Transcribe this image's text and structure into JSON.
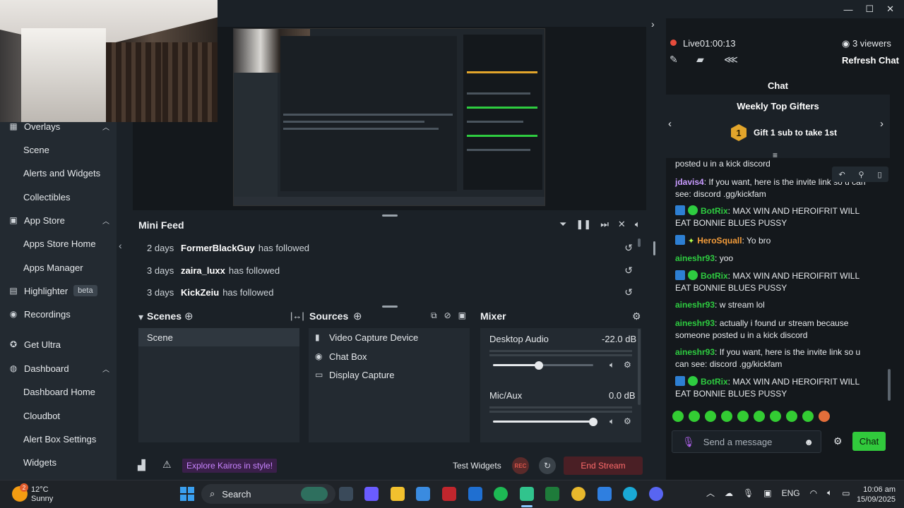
{
  "sidebar": {
    "items": [
      {
        "label": "Overlays",
        "icon": "grid-icon",
        "type": "head",
        "expanded": true
      },
      {
        "label": "Scene",
        "type": "sub"
      },
      {
        "label": "Alerts and Widgets",
        "type": "sub"
      },
      {
        "label": "Collectibles",
        "type": "sub"
      },
      {
        "label": "App Store",
        "icon": "store-icon",
        "type": "head",
        "expanded": true
      },
      {
        "label": "Apps Store Home",
        "type": "sub"
      },
      {
        "label": "Apps Manager",
        "type": "sub"
      },
      {
        "label": "Highlighter",
        "icon": "highlighter-icon",
        "type": "head",
        "badge": "beta"
      },
      {
        "label": "Recordings",
        "icon": "record-icon",
        "type": "head"
      },
      {
        "label": "Get Ultra",
        "icon": "ultra-icon",
        "type": "head"
      },
      {
        "label": "Dashboard",
        "icon": "dashboard-icon",
        "type": "head",
        "expanded": true
      },
      {
        "label": "Dashboard Home",
        "type": "sub"
      },
      {
        "label": "Cloudbot",
        "type": "sub"
      },
      {
        "label": "Alert Box Settings",
        "type": "sub"
      },
      {
        "label": "Widgets",
        "type": "sub"
      }
    ]
  },
  "mini_feed": {
    "title": "Mini Feed",
    "rows": [
      {
        "age": "2 days",
        "user": "FormerBlackGuy",
        "action": "has followed"
      },
      {
        "age": "3 days",
        "user": "zaira_luxx",
        "action": "has followed"
      },
      {
        "age": "3 days",
        "user": "KickZeiu",
        "action": "has followed"
      }
    ]
  },
  "scenes": {
    "title": "Scenes",
    "items": [
      "Scene"
    ]
  },
  "sources": {
    "title": "Sources",
    "items": [
      {
        "label": "Video Capture Device",
        "icon": "camera-icon"
      },
      {
        "label": "Chat Box",
        "icon": "chat-icon"
      },
      {
        "label": "Display Capture",
        "icon": "monitor-icon"
      }
    ]
  },
  "mixer": {
    "title": "Mixer",
    "channels": [
      {
        "label": "Desktop Audio",
        "db": "-22.0 dB",
        "level": 0.46
      },
      {
        "label": "Mic/Aux",
        "db": "0.0 dB",
        "level": 1.0
      }
    ]
  },
  "bottom_bar": {
    "kairos": "Explore Kairos in style!",
    "test_widgets": "Test Widgets",
    "rec": "REC",
    "end_stream": "End Stream"
  },
  "chat_panel": {
    "live": "Live",
    "live_time": "01:00:13",
    "viewers": "3 viewers",
    "refresh": "Refresh Chat",
    "header": "Chat",
    "gifters_title": "Weekly Top Gifters",
    "gift_rank": "1",
    "gift_text": "Gift 1 sub to take 1st",
    "messages": [
      {
        "user": "",
        "text": "posted u in a kick discord",
        "color": "#e6e9ec"
      },
      {
        "user": "jdavis4",
        "text": "If you want, here is the invite link so u can see: discord .gg/kickfam",
        "color": "#c89bff"
      },
      {
        "user": "BotRix",
        "text": "MAX WIN AND HEROIFRIT WILL EAT BONNIE BLUES PUSSY",
        "color": "#2ecc40",
        "bot": true
      },
      {
        "user": "HeroSquall",
        "text": "Yo bro",
        "color": "#f39c3a",
        "star": true
      },
      {
        "user": "aineshr93",
        "text": "yoo",
        "color": "#2ecc40"
      },
      {
        "user": "BotRix",
        "text": "MAX WIN AND HEROIFRIT WILL EAT BONNIE BLUES PUSSY",
        "color": "#2ecc40",
        "bot": true
      },
      {
        "user": "aineshr93",
        "text": "w stream lol",
        "color": "#2ecc40"
      },
      {
        "user": "aineshr93",
        "text": "actually i found ur stream because someone posted u in a kick discord",
        "color": "#2ecc40"
      },
      {
        "user": "aineshr93",
        "text": "If you want, here is the invite link so u can see: discord .gg/kickfam",
        "color": "#2ecc40"
      },
      {
        "user": "BotRix",
        "text": "MAX WIN AND HEROIFRIT WILL EAT BONNIE BLUES PUSSY",
        "color": "#2ecc40",
        "bot": true
      }
    ],
    "input_placeholder": "Send a message",
    "send": "Chat"
  },
  "taskbar": {
    "weather_badge": "2",
    "temp": "12°C",
    "condition": "Sunny",
    "search": "Search",
    "lang": "ENG",
    "time": "10:06 am",
    "date": "15/09/2025"
  },
  "colors": {
    "accent_green": "#31c93c",
    "end_stream_red": "#ff6b6b",
    "kairos_purple": "#c884ff"
  }
}
